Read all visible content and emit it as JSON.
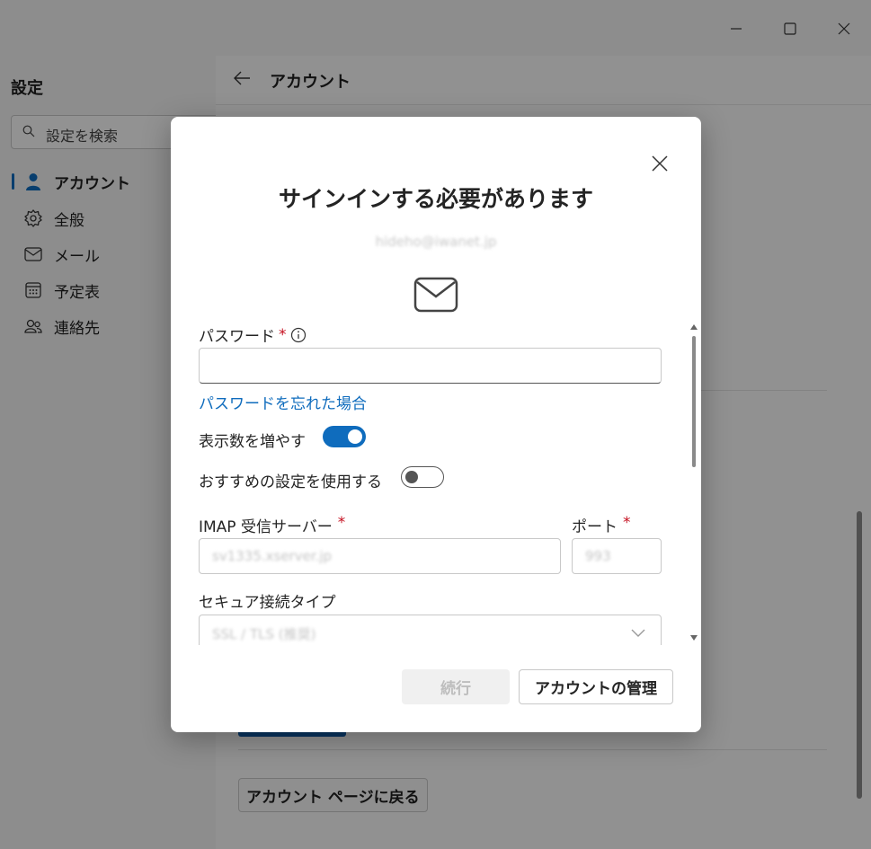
{
  "window": {
    "controls": [
      "minimize-icon",
      "maximize-icon",
      "close-icon"
    ]
  },
  "sidebar": {
    "title": "設定",
    "search_placeholder": "設定を検索",
    "items": [
      {
        "label": "アカウント",
        "icon": "person-icon",
        "active": true
      },
      {
        "label": "全般",
        "icon": "gear-icon",
        "active": false
      },
      {
        "label": "メール",
        "icon": "mail-icon",
        "active": false
      },
      {
        "label": "予定表",
        "icon": "calendar-icon",
        "active": false
      },
      {
        "label": "連絡先",
        "icon": "people-icon",
        "active": false
      }
    ]
  },
  "main": {
    "title": "アカウント",
    "back_page_button": "アカウント ページに戻る"
  },
  "dialog": {
    "title": "サインインする必要があります",
    "email": "hideho@iwanet.jp",
    "password_label": "パスワード",
    "required_mark": "*",
    "forgot_password_link": "パスワードを忘れた場合",
    "show_more_label": "表示数を増やす",
    "show_more_on": true,
    "use_recommended_label": "おすすめの設定を使用する",
    "use_recommended_on": false,
    "imap_server_label": "IMAP 受信サーバー",
    "imap_server_value": "sv1335.xserver.jp",
    "port_label": "ポート",
    "port_value": "993",
    "security_type_label": "セキュア接続タイプ",
    "security_type_value": "SSL / TLS (推奨)",
    "continue_button": "続行",
    "manage_account_button": "アカウントの管理"
  },
  "colors": {
    "accent": "#0f6cbd",
    "required": "#c50f1f",
    "overlay": "rgba(0,0,0,0.42)"
  }
}
